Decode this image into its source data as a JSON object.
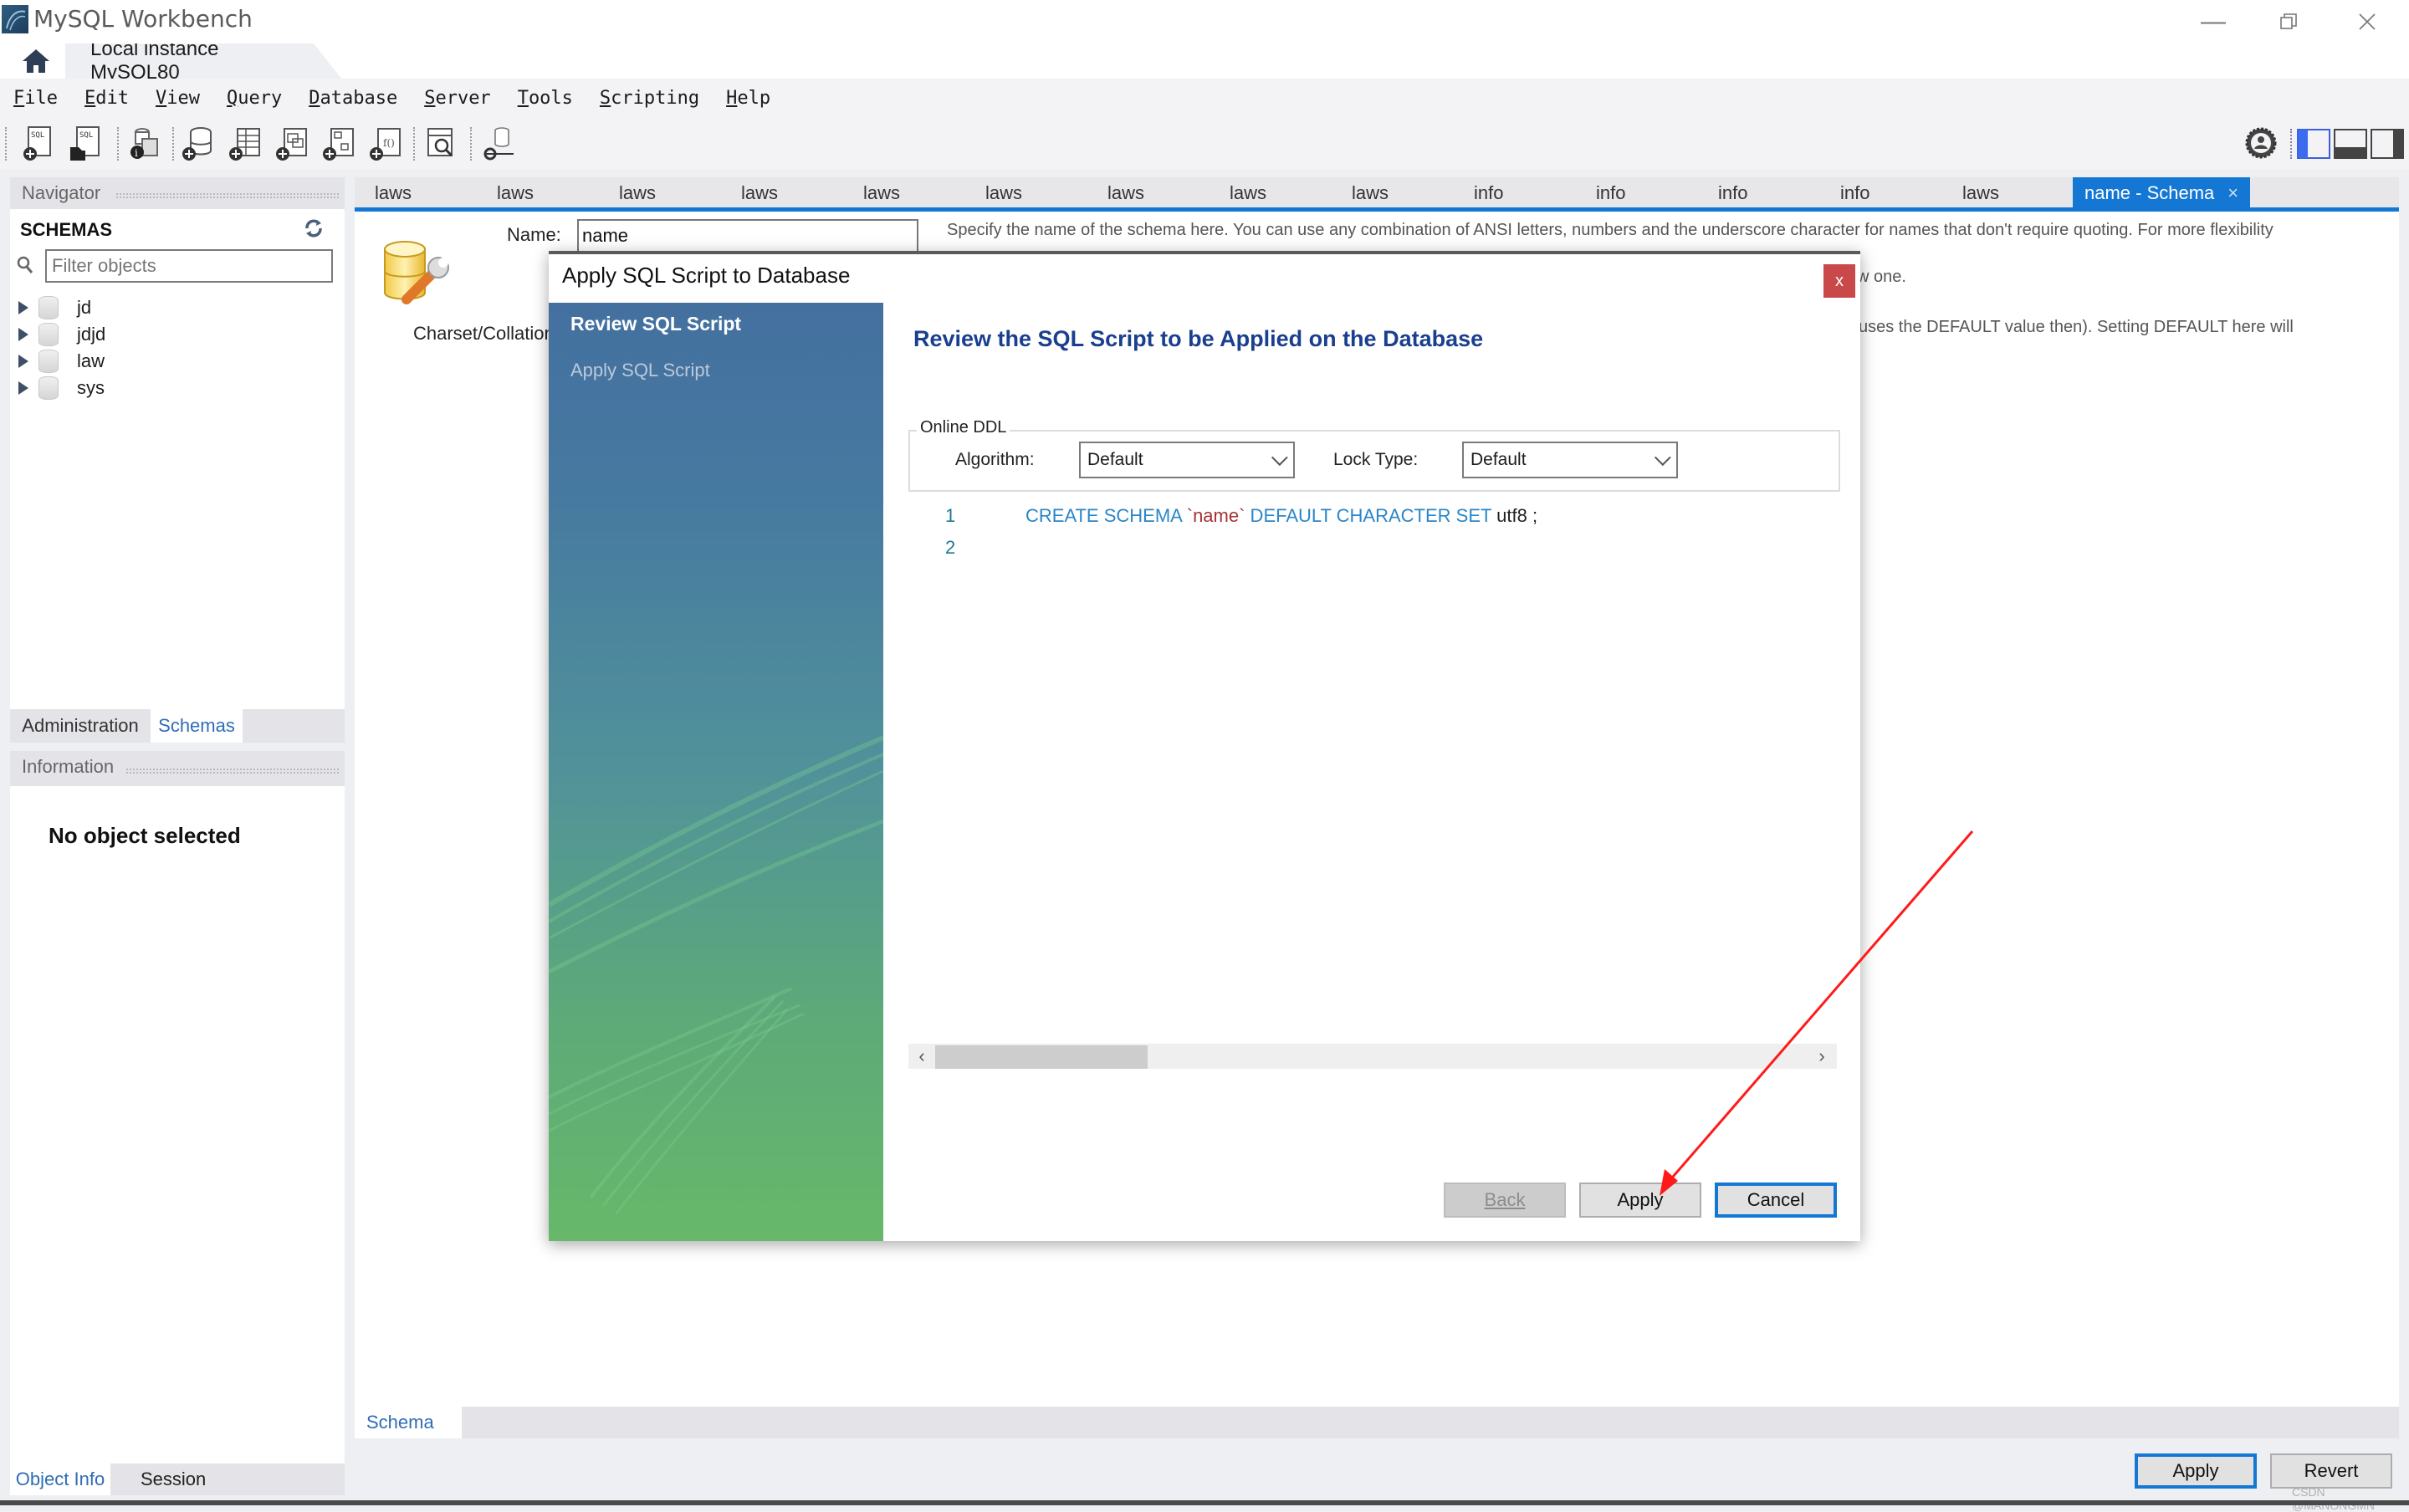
{
  "window": {
    "title": "MySQL Workbench",
    "controls": [
      "minimize",
      "restore",
      "close"
    ]
  },
  "connection_tabs": {
    "home_icon": "home-icon",
    "active_tab": "Local instance MySQL80",
    "close_glyph": "×"
  },
  "menubar": {
    "items": [
      {
        "label": "File",
        "mnemonic": "F"
      },
      {
        "label": "Edit",
        "mnemonic": "E"
      },
      {
        "label": "View",
        "mnemonic": "V"
      },
      {
        "label": "Query",
        "mnemonic": "Q"
      },
      {
        "label": "Database",
        "mnemonic": "D"
      },
      {
        "label": "Server",
        "mnemonic": "S"
      },
      {
        "label": "Tools",
        "mnemonic": "T"
      },
      {
        "label": "Scripting",
        "mnemonic": "S"
      },
      {
        "label": "Help",
        "mnemonic": "H"
      }
    ]
  },
  "toolbar": {
    "icons": [
      "new-sql-tab-icon",
      "open-sql-script-icon",
      "inspector-icon",
      "create-schema-icon",
      "create-table-icon",
      "create-view-icon",
      "create-procedure-icon",
      "create-function-icon",
      "search-table-data-icon",
      "reconnect-icon"
    ],
    "right_icons": [
      "preferences-gear-icon",
      "toggle-sidebar-icon",
      "toggle-output-icon",
      "toggle-secondary-sidebar-icon"
    ]
  },
  "navigator": {
    "header": "Navigator",
    "schemas_title": "SCHEMAS",
    "filter_placeholder": "Filter objects",
    "schemas": [
      "jd",
      "jdjd",
      "law",
      "sys"
    ],
    "bottom_tabs": {
      "administration": "Administration",
      "schemas": "Schemas",
      "active": "Schemas"
    }
  },
  "information": {
    "header": "Information",
    "message": "No object selected",
    "tabs": {
      "object_info": "Object Info",
      "session": "Session",
      "active": "Object Info"
    }
  },
  "editor_tabs": {
    "tabs": [
      "laws",
      "laws",
      "laws",
      "laws",
      "laws",
      "laws",
      "laws",
      "laws",
      "laws",
      "info",
      "info",
      "info",
      "info",
      "laws"
    ],
    "active_tab": "name - Schema",
    "close_glyph": "×"
  },
  "schema_editor": {
    "name_label": "Name:",
    "name_value": "name",
    "charset_label": "Charset/Collation",
    "help_line1": "Specify the name of the schema here. You can use any combination of ANSI letters, numbers and the underscore character for names that don't require quoting. For more flexibility",
    "help_line2_visible": "w one.",
    "help_line3_visible": "uses the DEFAULT value then). Setting DEFAULT here will",
    "bottom_tab": "Schema",
    "apply_label": "Apply",
    "revert_label": "Revert"
  },
  "dialog": {
    "title": "Apply SQL Script to Database",
    "close_glyph": "x",
    "steps": [
      {
        "label": "Review SQL Script",
        "state": "current"
      },
      {
        "label": "Apply SQL Script",
        "state": "pending"
      }
    ],
    "heading": "Review the SQL Script to be Applied on the Database",
    "online_ddl": {
      "legend": "Online DDL",
      "algorithm_label": "Algorithm:",
      "algorithm_value": "Default",
      "lock_label": "Lock Type:",
      "lock_value": "Default"
    },
    "script_lines": [
      {
        "number": "1",
        "tokens": [
          {
            "text": "CREATE SCHEMA ",
            "kind": "kw"
          },
          {
            "text": "`name`",
            "kind": "str"
          },
          {
            "text": " DEFAULT CHARACTER SET ",
            "kind": "kw"
          },
          {
            "text": "utf8 ;",
            "kind": "plain"
          }
        ]
      },
      {
        "number": "2",
        "tokens": []
      }
    ],
    "scroll_left": "‹",
    "scroll_right": "›",
    "buttons": {
      "back": "Back",
      "apply": "Apply",
      "cancel": "Cancel"
    }
  },
  "annotation": {
    "type": "red-arrow",
    "points_to": "dialog Apply button",
    "color": "#ff1a1a"
  },
  "watermark": "CSDN @MANONGMN",
  "colors": {
    "accent_blue": "#1477d4",
    "dialog_heading": "#1a3f8f",
    "close_red": "#c9484a",
    "sql_keyword": "#2a86c8",
    "sql_identifier": "#a33232"
  }
}
